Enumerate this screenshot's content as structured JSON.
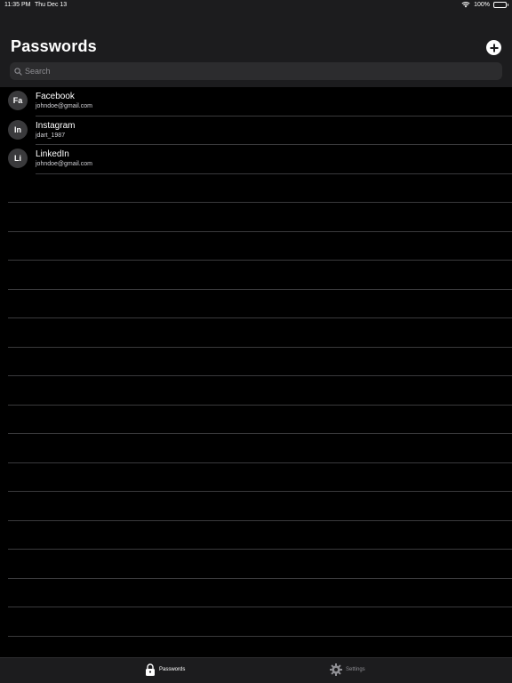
{
  "status_bar": {
    "time": "11:35 PM",
    "date": "Thu Dec 13",
    "battery": "100%"
  },
  "header": {
    "title": "Passwords",
    "add_icon": "plus-circle-icon"
  },
  "search": {
    "placeholder": "Search",
    "value": ""
  },
  "entries": [
    {
      "initials": "Fa",
      "name": "Facebook",
      "username": "johndoe@gmail.com"
    },
    {
      "initials": "In",
      "name": "Instagram",
      "username": "jdart_1987"
    },
    {
      "initials": "Li",
      "name": "LinkedIn",
      "username": "johndoe@gmail.com"
    }
  ],
  "tabs": [
    {
      "label": "Passwords",
      "icon": "lock-icon",
      "active": true
    },
    {
      "label": "Settings",
      "icon": "gear-icon",
      "active": false
    }
  ],
  "colors": {
    "background": "#000000",
    "bar_background": "#1c1c1e",
    "search_background": "#2c2c2e",
    "avatar_background": "#3a3a3c",
    "separator": "#3a3a3c",
    "inactive_tab": "#8e8e93"
  }
}
